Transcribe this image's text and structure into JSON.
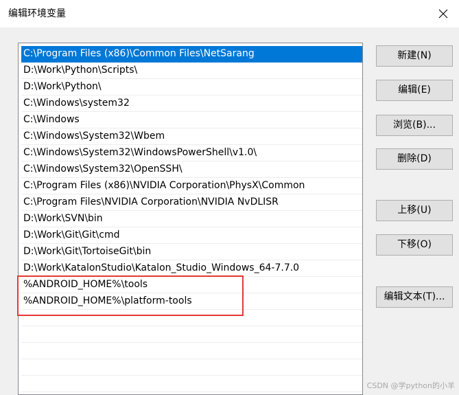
{
  "window": {
    "title": "编辑环境变量"
  },
  "icons": {
    "close": "close-icon"
  },
  "path_list": {
    "selected_index": 0,
    "entries": [
      "C:\\Program Files (x86)\\Common Files\\NetSarang",
      "D:\\Work\\Python\\Scripts\\",
      "D:\\Work\\Python\\",
      "C:\\Windows\\system32",
      "C:\\Windows",
      "C:\\Windows\\System32\\Wbem",
      "C:\\Windows\\System32\\WindowsPowerShell\\v1.0\\",
      "C:\\Windows\\System32\\OpenSSH\\",
      "C:\\Program Files (x86)\\NVIDIA Corporation\\PhysX\\Common",
      "C:\\Program Files\\NVIDIA Corporation\\NVIDIA NvDLISR",
      "D:\\Work\\SVN\\bin",
      "D:\\Work\\Git\\Git\\cmd",
      "D:\\Work\\Git\\TortoiseGit\\bin",
      "D:\\Work\\KatalonStudio\\Katalon_Studio_Windows_64-7.7.0",
      "%ANDROID_HOME%\\tools",
      "%ANDROID_HOME%\\platform-tools",
      "",
      "",
      "",
      "",
      ""
    ]
  },
  "buttons": {
    "new": "新建(N)",
    "edit": "编辑(E)",
    "browse": "浏览(B)...",
    "delete": "删除(D)",
    "move_up": "上移(U)",
    "move_down": "下移(O)",
    "edit_text": "编辑文本(T)..."
  },
  "colors": {
    "selection": "#0078d7",
    "highlight_border": "#e53935"
  },
  "watermark": "CSDN @学python的小羊"
}
